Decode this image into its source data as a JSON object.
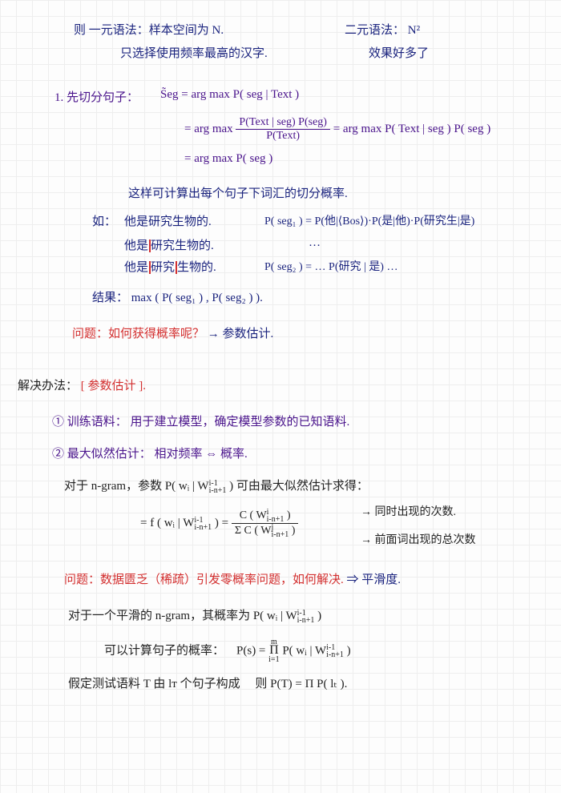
{
  "top": {
    "l1_left": "则 一元语法：样本空间为 N.",
    "l1_right": "二元语法： N²",
    "l2_left": "只选择使用频率最高的汉字.",
    "l2_right": "效果好多了"
  },
  "deriv": {
    "label": "1. 先切分句子：",
    "seg": "S̃eg",
    "eq1": " = arg max P( seg | Text )",
    "eq2a": " = arg max ",
    "eq2_num": "P(Text | seg) P(seg)",
    "eq2_den": "P(Text)",
    "eq2_right": " = arg max P( Text | seg ) P( seg )",
    "eq3": " = arg max P( seg )",
    "note": "这样可计算出每个句子下词汇的切分概率.",
    "ex_label": "如：",
    "ex_seg1": "他是研究生物的.",
    "ex_seg1_p": "P( seg₁ ) = P(他|⟨Bos⟩)·P(是|他)·P(研究生|是)",
    "ex_seg2_a": "他是",
    "ex_seg2_b": "研究生物的.",
    "ex_seg2_p": "…",
    "ex_seg3_a": "他是",
    "ex_seg3_b": "研究",
    "ex_seg3_c": "生物的.",
    "ex_seg3_p": "P( seg₂ ) =   …   P(研究 | 是) …",
    "result": "结果： max ( P( seg₁ ) , P( seg₂ ) ).",
    "q_label": "问题：如何获得概率呢？",
    "q_arrow": " → 参数估计."
  },
  "solve": {
    "head_black": "解决办法：",
    "head_red": "[ 参数估计 ].",
    "p1": "① 训练语料： 用于建立模型，确定模型参数的已知语料.",
    "p2": "② 最大似然估计： 相对频率 ⇔ 概率.",
    "ngram_a": "对于 n-gram，参数 P( wᵢ | ",
    "ngram_sub": "W",
    "ngram_stack_top": "i-1",
    "ngram_stack_bot": "i-n+1",
    "ngram_b": " ) 可由最大似然估计求得：",
    "mle_left": " = f ( wᵢ | ",
    "mle_mid": " ) = ",
    "mle_num": "C ( ",
    "mle_num_sub": "W",
    "mle_num_top": "i",
    "mle_num_bot": "i-n+1",
    "mle_num_close": " )",
    "mle_den_a": "Σ C ( ",
    "mle_den_sub": "W",
    "mle_den_top": "j",
    "mle_den_bot": "i-n+1",
    "mle_den_close": " )",
    "mle_note1": "→ 同时出现的次数.",
    "mle_note2": "→ 前面词出现的总次数",
    "q2_red": "问题：数据匮乏（稀疏）引发零概率问题，如何解决.",
    "q2_blue": " ⇒ 平滑度.",
    "smooth_a": "对于一个平滑的 n-gram，其概率为 P( wᵢ | ",
    "smooth_b": " )",
    "sentprob_a": "可以计算句子的概率：",
    "sentprob_b": "P(s) = ",
    "prod_top": "m",
    "prod_bot": "i=1",
    "sentprob_c": " P( wᵢ | ",
    "sentprob_d": " )",
    "test_a": "假定测试语料 T 由 lᴛ 个句子构成",
    "test_b": "则 P(T) = Π P( lₜ )."
  }
}
